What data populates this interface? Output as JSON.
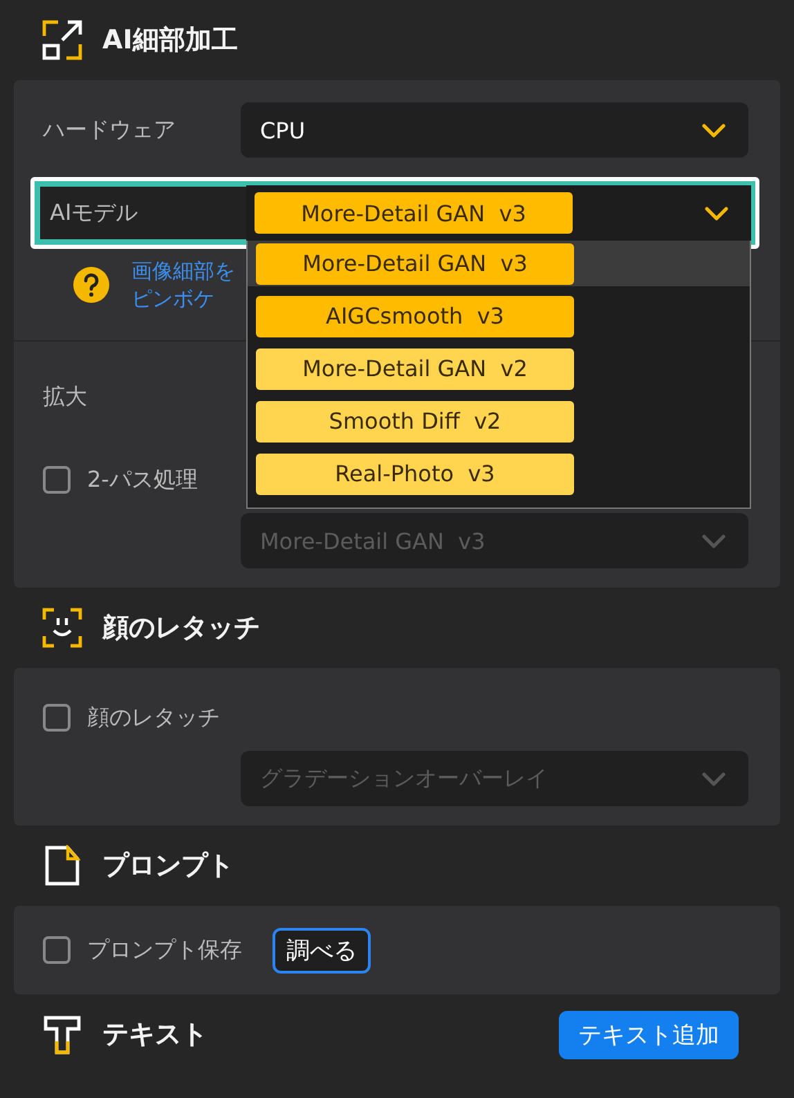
{
  "detail_section": {
    "title": "AI細部加工",
    "hardware": {
      "label": "ハードウェア",
      "value": "CPU"
    },
    "model": {
      "label": "AIモデル",
      "value": "More-Detail GAN  v3",
      "highlighted": true,
      "expanded": true,
      "options": [
        {
          "label": "More-Detail GAN  v3",
          "selected": true,
          "color": "#ffbb00"
        },
        {
          "label": "AIGCsmooth  v3",
          "selected": false,
          "color": "#ffbb00"
        },
        {
          "label": "More-Detail GAN  v2",
          "selected": false,
          "color": "#ffd54f"
        },
        {
          "label": "Smooth Diff  v2",
          "selected": false,
          "color": "#ffd54f"
        },
        {
          "label": "Real-Photo  v3",
          "selected": false,
          "color": "#ffd54f"
        }
      ]
    },
    "help_lines": [
      "画像細部を",
      "ピンボケ"
    ],
    "scale": {
      "label": "拡大"
    },
    "two_pass": {
      "label": "2-パス処理",
      "checked": false,
      "model_value": "More-Detail GAN  v3",
      "disabled": true
    }
  },
  "face_section": {
    "title": "顔のレタッチ",
    "retouch": {
      "label": "顔のレタッチ",
      "checked": false
    },
    "style": {
      "value": "グラデーションオーバーレイ",
      "disabled": true
    }
  },
  "prompt_section": {
    "title": "プロンプト",
    "save": {
      "label": "プロンプト保存",
      "checked": false
    },
    "button": "調べる"
  },
  "text_section": {
    "title": "テキスト",
    "button": "テキスト追加"
  }
}
